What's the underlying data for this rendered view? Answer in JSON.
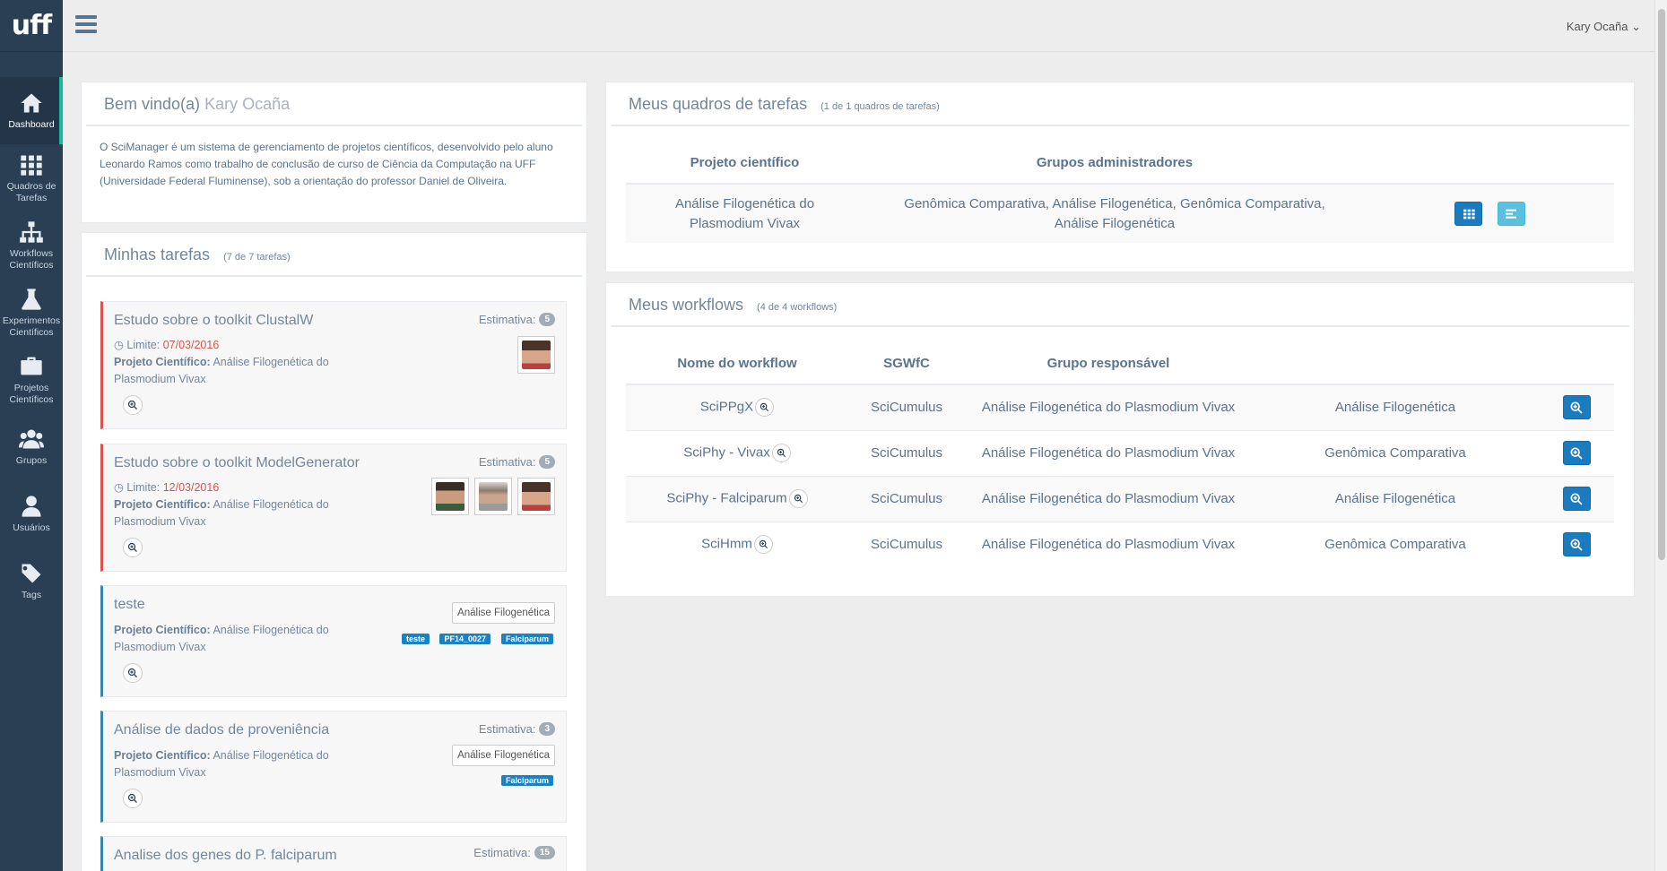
{
  "brand": {
    "logo_text": "uff"
  },
  "sidebar": {
    "items": [
      {
        "label": "Dashboard",
        "icon": "home-icon"
      },
      {
        "label": "Quadros de Tarefas",
        "icon": "grid-icon"
      },
      {
        "label": "Workflows Científicos",
        "icon": "sitemap-icon"
      },
      {
        "label": "Experimentos Científicos",
        "icon": "flask-icon"
      },
      {
        "label": "Projetos Científicos",
        "icon": "briefcase-icon"
      },
      {
        "label": "Grupos",
        "icon": "users-icon"
      },
      {
        "label": "Usuários",
        "icon": "user-icon"
      },
      {
        "label": "Tags",
        "icon": "tags-icon"
      }
    ]
  },
  "topbar": {
    "user_name": "Kary Ocaña"
  },
  "welcome": {
    "title_prefix": "Bem vindo(a)",
    "user_name": "Kary Ocaña",
    "text": "O SciManager é um sistema de gerenciamento de projetos científicos, desenvolvido pelo aluno Leonardo Ramos como trabalho de conclusão de curso de Ciência da Computação na UFF (Universidade Federal Fluminense), sob a orientação do professor Daniel de Oliveira."
  },
  "tasks": {
    "title": "Minhas tarefas",
    "count": "(7 de 7 tarefas)",
    "estimate_label": "Estimativa:",
    "limit_label": "Limite:",
    "project_label": "Projeto Científico:",
    "items": [
      {
        "title": "Estudo sobre o toolkit ClustalW",
        "estimate": "5",
        "limit": "07/03/2016",
        "project": "Análise Filogenética do Plasmodium Vivax"
      },
      {
        "title": "Estudo sobre o toolkit ModelGenerator",
        "estimate": "5",
        "limit": "12/03/2016",
        "project": "Análise Filogenética do Plasmodium Vivax"
      },
      {
        "title": "teste",
        "group": "Análise Filogenética",
        "project": "Análise Filogenética do Plasmodium Vivax",
        "tags": [
          "teste",
          "PF14_0027",
          "Falciparum"
        ]
      },
      {
        "title": "Análise de dados de proveniência",
        "estimate": "3",
        "group": "Análise Filogenética",
        "project": "Análise Filogenética do Plasmodium Vivax",
        "tags": [
          "Falciparum"
        ]
      },
      {
        "title": "Analise dos genes do P. falciparum",
        "estimate": "15"
      }
    ]
  },
  "boards": {
    "title": "Meus quadros de tarefas",
    "count": "(1 de 1 quadros de tarefas)",
    "headers": [
      "Projeto científico",
      "Grupos administradores"
    ],
    "rows": [
      {
        "project": "Análise Filogenética do Plasmodium Vivax",
        "groups": "Genômica Comparativa, Análise Filogenética, Genômica Comparativa, Análise Filogenética"
      }
    ]
  },
  "workflows": {
    "title": "Meus workflows",
    "count": "(4 de 4 workflows)",
    "headers": [
      "Nome do workflow",
      "SGWfC",
      "Grupo responsável"
    ],
    "rows": [
      {
        "name": "SciPPgX",
        "sgwfc": "SciCumulus",
        "project": "Análise Filogenética do Plasmodium Vivax",
        "group": "Análise Filogenética"
      },
      {
        "name": "SciPhy - Vivax",
        "sgwfc": "SciCumulus",
        "project": "Análise Filogenética do Plasmodium Vivax",
        "group": "Genômica Comparativa"
      },
      {
        "name": "SciPhy - Falciparum",
        "sgwfc": "SciCumulus",
        "project": "Análise Filogenética do Plasmodium Vivax",
        "group": "Análise Filogenética"
      },
      {
        "name": "SciHmm",
        "sgwfc": "SciCumulus",
        "project": "Análise Filogenética do Plasmodium Vivax",
        "group": "Genômica Comparativa"
      }
    ]
  },
  "colors": {
    "sidebar": "#2a3f54",
    "accent": "#1abb9c",
    "primary": "#1a7bbf",
    "danger": "#d9534f"
  }
}
